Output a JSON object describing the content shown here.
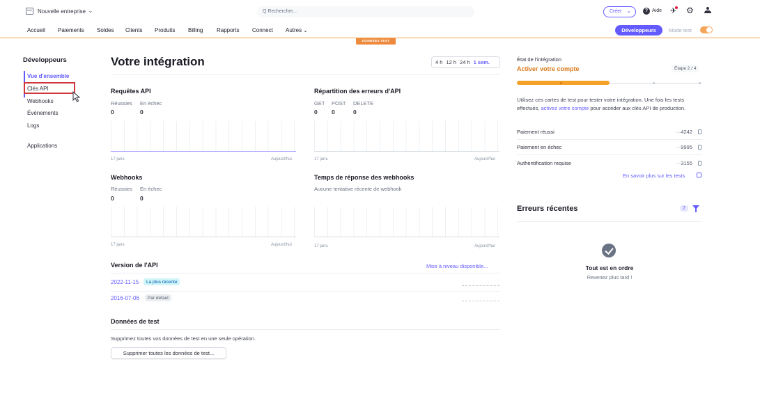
{
  "topbar": {
    "business": "Nouvelle entreprise",
    "search_placeholder": "Q Rechercher...",
    "create_label": "Créer",
    "help_label": "Aide"
  },
  "nav": {
    "items": [
      "Accueil",
      "Paiements",
      "Soldes",
      "Clients",
      "Produits",
      "Billing",
      "Rapports",
      "Connect",
      "Autres"
    ],
    "developers_label": "Développeurs",
    "test_mode_label": "Mode test",
    "test_badge": "DONNÉES TEST"
  },
  "sidebar": {
    "title": "Développeurs",
    "items": [
      "Vue d'ensemble",
      "Clés API",
      "Webhooks",
      "Événements",
      "Logs",
      "Applications"
    ]
  },
  "main": {
    "title": "Votre intégration",
    "ranges": [
      "4 h",
      "12 h",
      "24 h",
      "1 sem."
    ],
    "api_requests": {
      "title": "Requêtes API",
      "success_label": "Réussies",
      "failed_label": "En échec",
      "success_value": "0",
      "failed_value": "0",
      "axis_start": "17 janv.",
      "axis_end": "Aujourd'hui"
    },
    "api_errors": {
      "title": "Répartition des erreurs d'API",
      "labels": [
        "GET",
        "POST",
        "DELETE"
      ],
      "values": [
        "0",
        "0",
        "0"
      ],
      "axis_start": "17 janv.",
      "axis_end": "Aujourd'hui"
    },
    "webhooks": {
      "title": "Webhooks",
      "success_label": "Réussies",
      "failed_label": "En échec",
      "success_value": "0",
      "failed_value": "0",
      "axis_start": "17 janv.",
      "axis_end": "Aujourd'hui"
    },
    "webhook_time": {
      "title": "Temps de réponse des webhooks",
      "subtitle": "Aucune tentative récente de webhook",
      "axis_start": "17 janv.",
      "axis_end": "Aujourd'hui"
    },
    "api_version": {
      "title": "Version de l'API",
      "upgrade_label": "Mise à niveau disponible...",
      "rows": [
        {
          "version": "2022-11-15",
          "badge": "La plus récente"
        },
        {
          "version": "2016-07-06",
          "badge": "Par défaut"
        }
      ]
    },
    "test_data": {
      "title": "Données de test",
      "description": "Supprimez toutes vos données de test en une seule opération.",
      "button_label": "Supprimer toutes les données de test..."
    }
  },
  "right": {
    "status_label": "État de l'intégration",
    "activate_label": "Activer votre compte",
    "step_label": "Étape 2 / 4",
    "progress": 0.5,
    "description_before": "Utilisez ces cartes de test pour tester votre intégration. Une fois les tests effectués,",
    "description_link": "activez votre compte",
    "description_after": "pour accéder aux clés API de production.",
    "cards": [
      {
        "label": "Paiement réussi",
        "number": "···4242"
      },
      {
        "label": "Paiement en échec",
        "number": "···9995"
      },
      {
        "label": "Authentification requise",
        "number": "···3155"
      }
    ],
    "learn_more": "En savoir plus sur les tests",
    "errors_title": "Erreurs récentes",
    "errors_count": "2",
    "ok_title": "Tout est en ordre",
    "ok_subtitle": "Revenez plus tard !"
  },
  "colors": {
    "accent": "#635bff",
    "test_orange": "#f5a027",
    "highlight_red": "#d0363d"
  }
}
